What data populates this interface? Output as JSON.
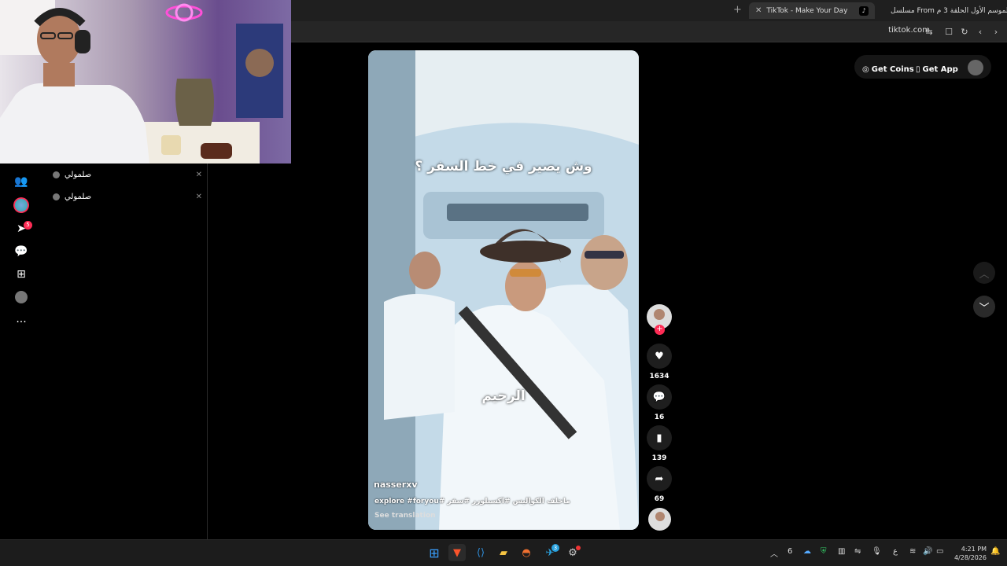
{
  "browser": {
    "tabs": [
      {
        "label": "مسلسل From الموسم الأول الحلقة 3 م..."
      },
      {
        "label": "TikTok - Make Your Day"
      }
    ],
    "url": "tiktok.com"
  },
  "tiktok": {
    "header": {
      "get_coins": "Get Coins",
      "get_app": "Get App"
    },
    "sidebar": {
      "notification_badge": "5",
      "more_label": "..."
    },
    "search_history": [
      {
        "label": "صلمولي"
      },
      {
        "label": "صلمولي"
      }
    ],
    "video": {
      "caption_top": "وش يصير في خط السفر ؟",
      "caption_mid": "الرحيم",
      "username": "nasserxv",
      "description": "ماخلف الكواليس #اكسبلورر #سفر #explore #foryou",
      "see_translation": "See translation"
    },
    "actions": {
      "likes": "1634",
      "comments": "16",
      "saves": "139",
      "shares": "69"
    }
  },
  "taskbar": {
    "time": "4:21 PM",
    "date": "4/28/2026",
    "telegram_badge": "3",
    "lang": "ع"
  },
  "colors": {
    "accent": "#fe2c55",
    "tab_active": "#333333",
    "taskbar": "#1c1c1c"
  }
}
